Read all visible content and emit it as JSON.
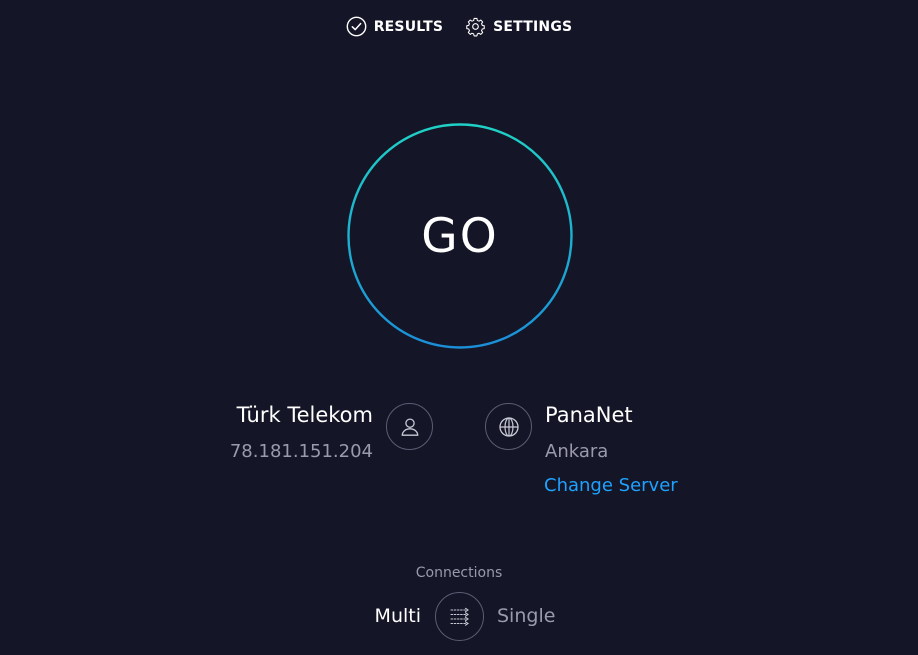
{
  "nav": {
    "results_label": "RESULTS",
    "settings_label": "SETTINGS"
  },
  "go_button": {
    "label": "GO"
  },
  "isp": {
    "name": "Türk Telekom",
    "ip": "78.181.151.204",
    "icon": "user-icon"
  },
  "server": {
    "name": "PanaNet",
    "city": "Ankara",
    "change_label": "Change Server",
    "icon": "globe-icon"
  },
  "connections": {
    "label": "Connections",
    "multi_label": "Multi",
    "single_label": "Single",
    "selected": "Multi",
    "icon": "connections-toggle-icon"
  },
  "colors": {
    "background": "#141526",
    "ring_start": "#1fd1c6",
    "ring_end": "#1b8fd8",
    "link": "#1fa2ff",
    "muted_text": "#9a9aad"
  }
}
